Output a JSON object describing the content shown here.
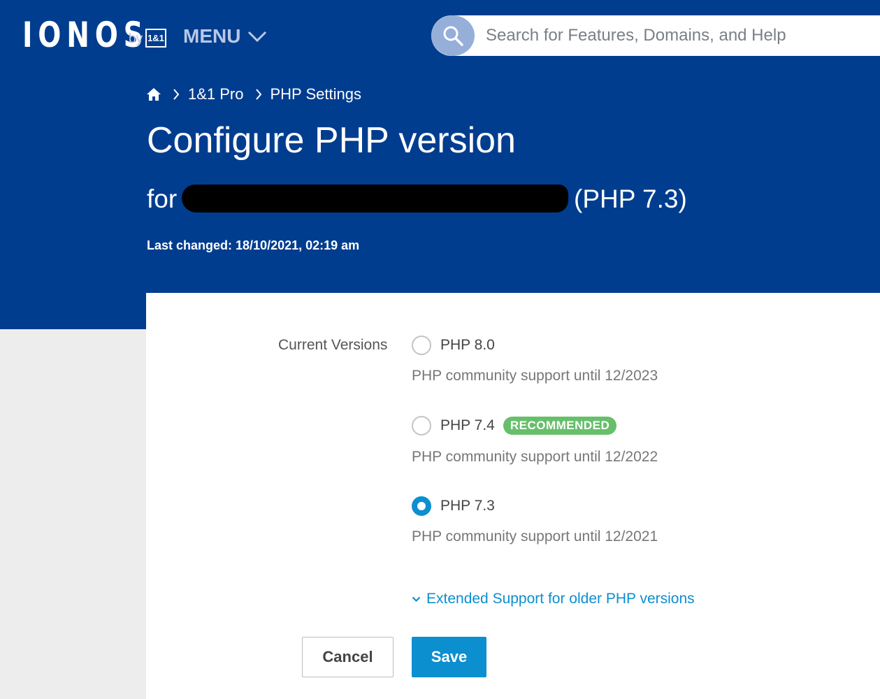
{
  "header": {
    "logo_text": "IONOS",
    "logo_by": "by",
    "logo_box": "1&1",
    "menu_label": "MENU",
    "search_placeholder": "Search for Features, Domains, and Help"
  },
  "breadcrumb": {
    "home_icon": "home-icon",
    "items": [
      "1&1 Pro",
      "PHP Settings"
    ]
  },
  "page": {
    "title": "Configure PHP version",
    "for_prefix": "for",
    "current_version": "(PHP 7.3)",
    "last_changed": "Last changed: 18/10/2021, 02:19 am"
  },
  "form": {
    "section_label": "Current Versions",
    "options": [
      {
        "label": "PHP 8.0",
        "support": "PHP community support until 12/2023",
        "selected": false,
        "badge": ""
      },
      {
        "label": "PHP 7.4",
        "support": "PHP community support until 12/2022",
        "selected": false,
        "badge": "RECOMMENDED"
      },
      {
        "label": "PHP 7.3",
        "support": "PHP community support until 12/2021",
        "selected": true,
        "badge": ""
      }
    ],
    "extended_link": "Extended Support for older PHP versions",
    "cancel_label": "Cancel",
    "save_label": "Save"
  },
  "colors": {
    "brand_blue": "#003d8f",
    "accent": "#0b8fcf",
    "recommended_green": "#67bf6b"
  }
}
